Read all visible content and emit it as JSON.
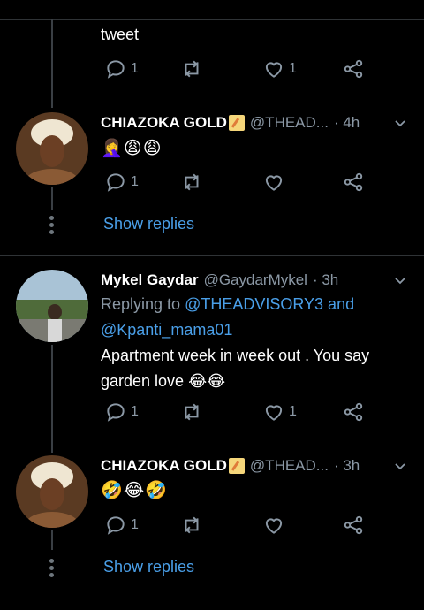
{
  "top_tweet": {
    "text": "tweet",
    "reply_count": "1",
    "like_count": "1"
  },
  "tweets": [
    {
      "name": "CHIAZOKA GOLD",
      "handle": "@THEAD...",
      "time": "· 4h",
      "emoji_text": "🤦‍♀️😩😩",
      "reply_count": "1",
      "show_replies": "Show replies"
    },
    {
      "name": "Mykel Gaydar",
      "handle": "@GaydarMykel",
      "time": "· 3h",
      "replying_prefix": "Replying to",
      "replying_users_1": "@THEADVISORY3 and",
      "replying_users_2": "@Kpanti_mama01",
      "body_line1": "Apartment week in week out . You say",
      "body_line2": "garden love 😂😂",
      "reply_count": "1",
      "like_count": "1"
    },
    {
      "name": "CHIAZOKA GOLD",
      "handle": "@THEAD...",
      "time": "· 3h",
      "emoji_text": "🤣😂🤣",
      "reply_count": "1",
      "show_replies": "Show replies"
    }
  ],
  "icons": [
    "reply-icon",
    "retweet-icon",
    "like-icon",
    "share-icon",
    "chevron-down-icon",
    "memo-pencil-icon"
  ],
  "colors": {
    "background": "#000000",
    "link": "#4a9fe8",
    "muted": "#8b98a5",
    "divider": "#2f3336"
  }
}
